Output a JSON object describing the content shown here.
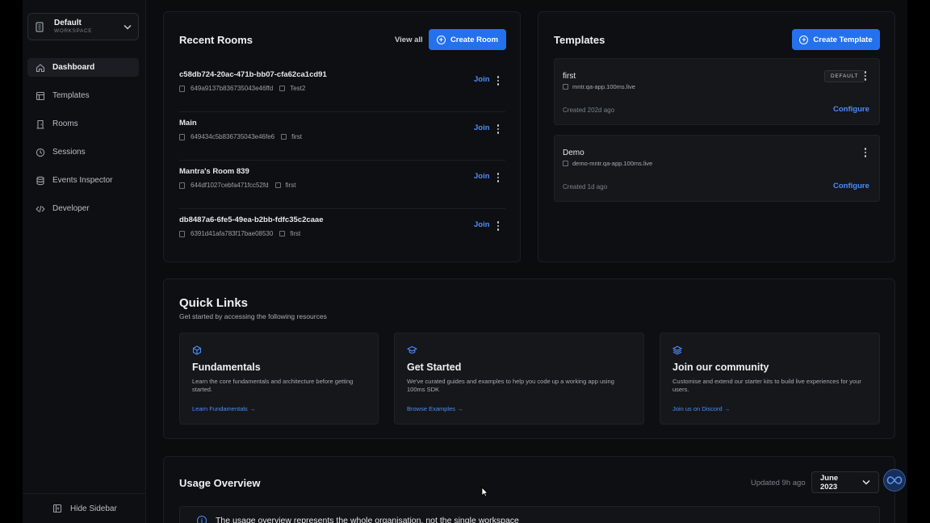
{
  "workspace": {
    "name": "Default",
    "label": "WORKSPACE"
  },
  "sidebar": {
    "items": [
      {
        "label": "Dashboard",
        "icon": "home-icon",
        "active": true
      },
      {
        "label": "Templates",
        "icon": "template-icon"
      },
      {
        "label": "Rooms",
        "icon": "door-icon"
      },
      {
        "label": "Sessions",
        "icon": "clock-icon"
      },
      {
        "label": "Events Inspector",
        "icon": "database-icon"
      },
      {
        "label": "Developer",
        "icon": "code-icon"
      }
    ],
    "hide_label": "Hide Sidebar"
  },
  "recent_rooms": {
    "title": "Recent Rooms",
    "view_all": "View all",
    "create_label": "Create Room",
    "join_label": "Join",
    "rooms": [
      {
        "name": "c58db724-20ac-471b-bb07-cfa62ca1cd91",
        "id": "649a9137b836735043e46ffd",
        "template": "Test2"
      },
      {
        "name": "Main",
        "id": "649434c5b836735043e46fe6",
        "template": "first"
      },
      {
        "name": "Mantra's Room 839",
        "id": "644df1027cebfa471fcc52fd",
        "template": "first"
      },
      {
        "name": "db8487a6-6fe5-49ea-b2bb-fdfc35c2caae",
        "id": "6391d41afa783f17bae08530",
        "template": "first"
      }
    ]
  },
  "templates": {
    "title": "Templates",
    "create_label": "Create Template",
    "configure_label": "Configure",
    "items": [
      {
        "name": "first",
        "domain": "mntr.qa-app.100ms.live",
        "created": "Created 202d ago",
        "badge": "DEFAULT"
      },
      {
        "name": "Demo",
        "domain": "demo-mntr.qa-app.100ms.live",
        "created": "Created 1d ago",
        "badge": ""
      }
    ]
  },
  "quick_links": {
    "title": "Quick Links",
    "subtitle": "Get started by accessing the following resources",
    "cards": [
      {
        "title": "Fundamentals",
        "desc": "Learn the core fundamentals and architecture before getting started.",
        "link": "Learn Fundamentals →",
        "icon": "cube-icon"
      },
      {
        "title": "Get Started",
        "desc": "We've curated guides and examples to help you code up a working app using 100ms SDK",
        "link": "Browse Examples →",
        "icon": "graduation-cap-icon"
      },
      {
        "title": "Join our community",
        "desc": "Customise and extend our starter kits to build live experiences for your users.",
        "link": "Join us on Discord →",
        "icon": "layers-icon"
      }
    ]
  },
  "usage": {
    "title": "Usage Overview",
    "updated": "Updated 9h ago",
    "month": "June 2023",
    "note": "The usage overview represents the whole organisation, not the single workspace"
  },
  "colors": {
    "accent": "#2471ed",
    "link": "#4b8df8",
    "background": "#0b0c0e",
    "card": "#0e0f12"
  }
}
